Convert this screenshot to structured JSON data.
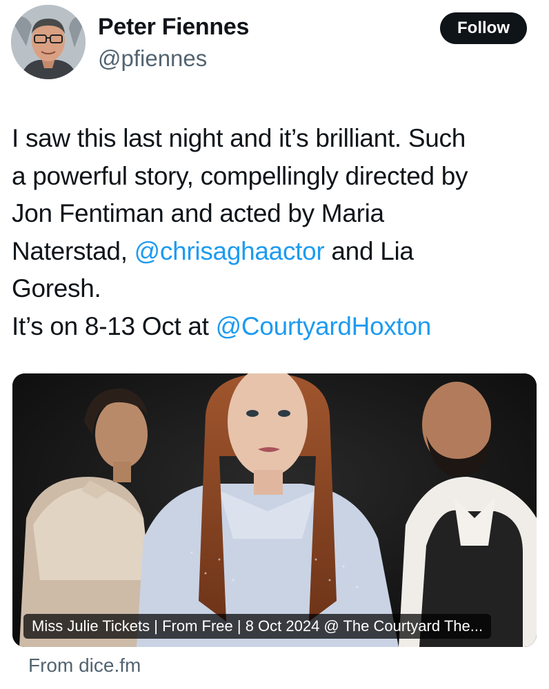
{
  "author": {
    "name": "Peter Fiennes",
    "handle": "@pfiennes",
    "follow_label": "Follow"
  },
  "tweet": {
    "lines": [
      [
        {
          "text": "I saw this last night and it’s brilliant. Such"
        }
      ],
      [
        {
          "text": "a powerful story, compellingly directed by"
        }
      ],
      [
        {
          "text": "Jon Fentiman and acted by Maria"
        }
      ],
      [
        {
          "text": "Naterstad, "
        },
        {
          "text": "@chrisaghaactor",
          "mention": true
        },
        {
          "text": " and Lia"
        }
      ],
      [
        {
          "text": "Goresh."
        }
      ],
      [
        {
          "text": "It’s on 8-13 Oct at "
        },
        {
          "text": "@CourtyardHoxton",
          "mention": true
        }
      ]
    ]
  },
  "link_card": {
    "title": "Miss Julie Tickets | From Free | 8 Oct 2024 @ The Courtyard The...",
    "source": "From dice.fm"
  },
  "colors": {
    "mention": "#1d9bf0",
    "follow_bg": "#0f1419",
    "secondary_text": "#536471"
  }
}
